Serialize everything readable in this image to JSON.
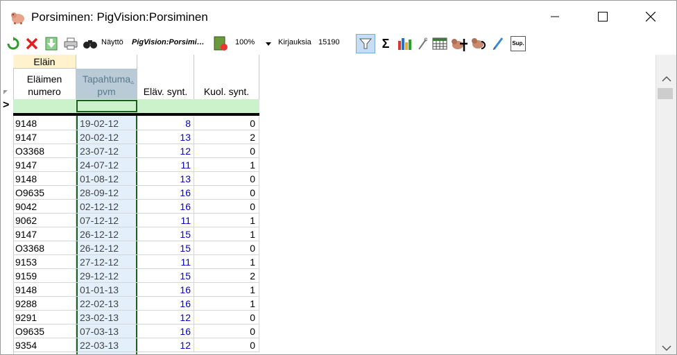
{
  "window": {
    "title": "Porsiminen: PigVision:Porsiminen"
  },
  "toolbar": {
    "view_label": "Näyttö",
    "view_select": "PigVision:Porsimi…",
    "zoom": "100%",
    "records_label": "Kirjauksia",
    "records_count": "15190",
    "sup_label": "Sup."
  },
  "grid": {
    "group_header": "Eläin",
    "columns": [
      {
        "key": "animal",
        "label": "Eläimen numero"
      },
      {
        "key": "date",
        "label": "Tapahtuma pvm"
      },
      {
        "key": "live",
        "label": "Eläv. synt."
      },
      {
        "key": "dead",
        "label": "Kuol. synt."
      }
    ],
    "rows": [
      {
        "animal": "9148",
        "date": "19-02-12",
        "live": "8",
        "dead": "0"
      },
      {
        "animal": "9147",
        "date": "20-02-12",
        "live": "13",
        "dead": "2"
      },
      {
        "animal": "O3368",
        "date": "23-07-12",
        "live": "12",
        "dead": "0"
      },
      {
        "animal": "9147",
        "date": "24-07-12",
        "live": "11",
        "dead": "1"
      },
      {
        "animal": "9148",
        "date": "01-08-12",
        "live": "13",
        "dead": "0"
      },
      {
        "animal": "O9635",
        "date": "28-09-12",
        "live": "16",
        "dead": "0"
      },
      {
        "animal": "9042",
        "date": "02-12-12",
        "live": "16",
        "dead": "0"
      },
      {
        "animal": "9062",
        "date": "07-12-12",
        "live": "11",
        "dead": "1"
      },
      {
        "animal": "9147",
        "date": "26-12-12",
        "live": "15",
        "dead": "1"
      },
      {
        "animal": "O3368",
        "date": "26-12-12",
        "live": "15",
        "dead": "0"
      },
      {
        "animal": "9153",
        "date": "27-12-12",
        "live": "11",
        "dead": "1"
      },
      {
        "animal": "9159",
        "date": "29-12-12",
        "live": "15",
        "dead": "2"
      },
      {
        "animal": "9148",
        "date": "01-01-13",
        "live": "16",
        "dead": "1"
      },
      {
        "animal": "9288",
        "date": "22-02-13",
        "live": "16",
        "dead": "1"
      },
      {
        "animal": "9291",
        "date": "23-02-13",
        "live": "12",
        "dead": "0"
      },
      {
        "animal": "O9635",
        "date": "07-03-13",
        "live": "16",
        "dead": "0"
      },
      {
        "animal": "9354",
        "date": "22-03-13",
        "live": "12",
        "dead": "0"
      }
    ]
  },
  "colors": {
    "group_header_bg": "#fff2cc",
    "date_column_bg": "#e3f0fb",
    "sorted_header_bg": "#b9cbd6",
    "filter_row_bg": "#ccf2cc",
    "live_value_color": "#0000cc",
    "date_text_color": "#444444",
    "current_cell_border": "#1c5c1c"
  }
}
